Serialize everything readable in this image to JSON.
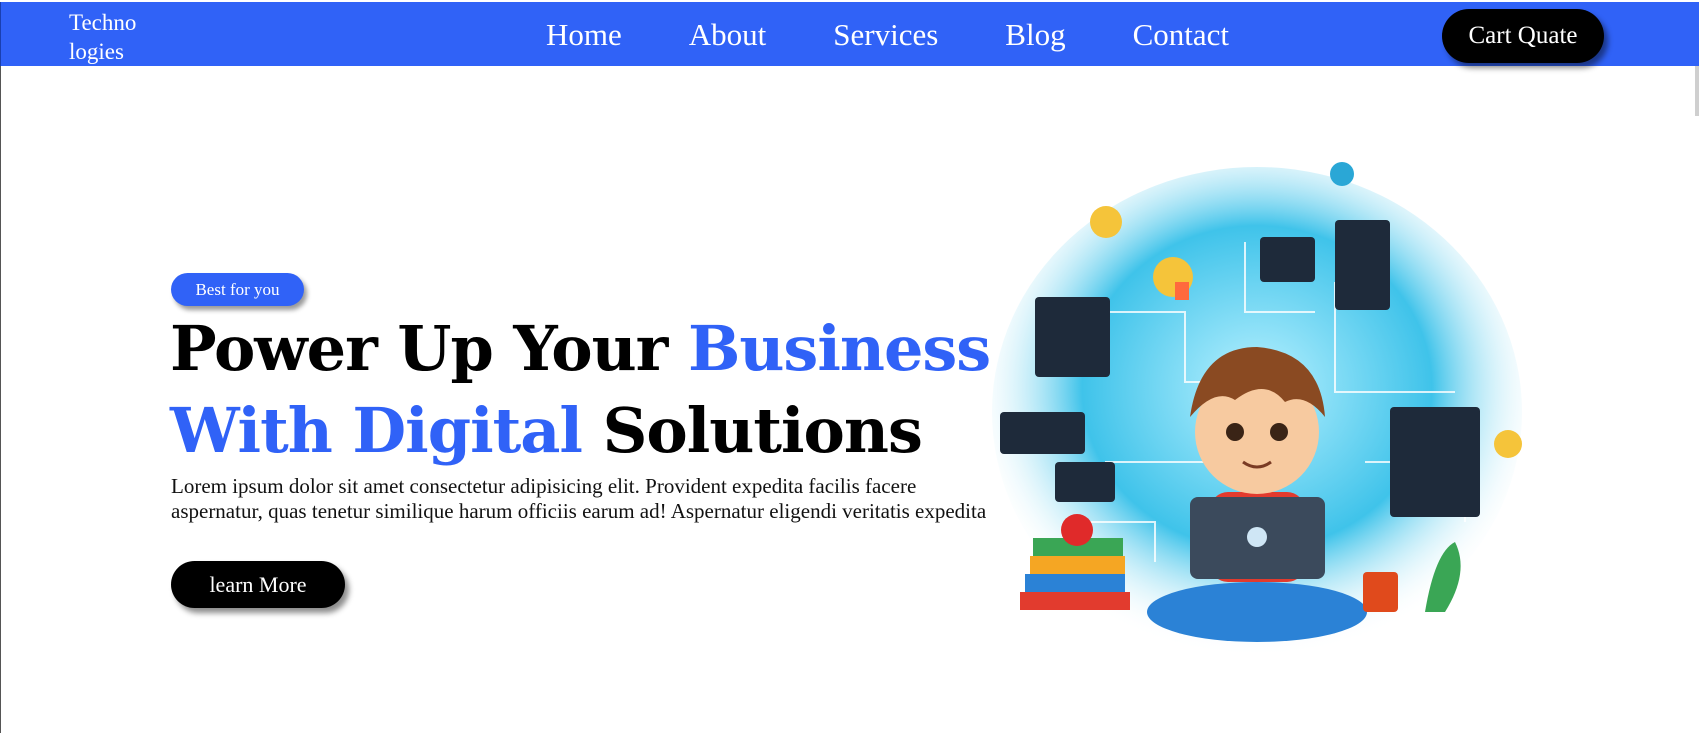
{
  "brand": {
    "logo_line1": "Techno",
    "logo_line2": "logies"
  },
  "nav": {
    "items": [
      {
        "label": "Home"
      },
      {
        "label": "About"
      },
      {
        "label": "Services"
      },
      {
        "label": "Blog"
      },
      {
        "label": "Contact"
      }
    ],
    "cart_label": "Cart Quate"
  },
  "hero": {
    "badge": "Best for you",
    "headline": {
      "part1": "Power Up Your ",
      "part2_blue": "Business",
      "part3_blue": "With Digital",
      "part4": " Solutions"
    },
    "lead": "Lorem ipsum dolor sit amet consectetur adipisicing elit. Provident expedita facilis facere aspernatur, quas tenetur similique harum officiis earum ad! Aspernatur eligendi veritatis expedita",
    "cta_label": "learn More"
  },
  "colors": {
    "primary": "#3062f7",
    "dark": "#000000",
    "text": "#111111"
  }
}
